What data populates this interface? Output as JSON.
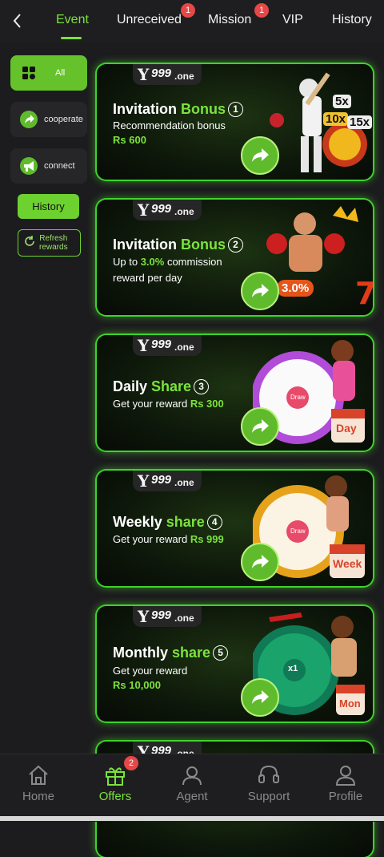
{
  "nav": {
    "back_icon": "chevron-left-icon",
    "tabs": [
      {
        "label": "Event",
        "active": true
      },
      {
        "label": "Unreceived",
        "badge": "1"
      },
      {
        "label": "Mission",
        "badge": "1"
      },
      {
        "label": "VIP"
      },
      {
        "label": "History"
      }
    ]
  },
  "sidebar": {
    "items": [
      {
        "label": "All",
        "icon": "grid-icon",
        "active": true
      },
      {
        "label": "cooperate",
        "icon": "share-arrow-icon"
      },
      {
        "label": "connect",
        "icon": "megaphone-icon"
      }
    ],
    "history_label": "History",
    "refresh_label_1": "Refresh",
    "refresh_label_2": "rewards"
  },
  "brand": {
    "y": "Y",
    "n": "999",
    "one": ".one"
  },
  "cards": [
    {
      "title_a": "Invitation ",
      "title_b": "Bonus",
      "num": "1",
      "line1": "Recommendation bonus",
      "line2_amount": "Rs 600"
    },
    {
      "title_a": "Invitation ",
      "title_b": "Bonus",
      "num": "2",
      "line1_pre": "Up to ",
      "line1_hi": "3.0%",
      "line1_post": " commission",
      "line2": "reward per day"
    },
    {
      "title_a": "Daily ",
      "title_b": "Share",
      "num": "3",
      "line1_pre": "Get your reward ",
      "line1_hi": "Rs 300"
    },
    {
      "title_a": "Weekly ",
      "title_b": "share",
      "num": "4",
      "line1_pre": "Get your reward ",
      "line1_hi": "Rs 999"
    },
    {
      "title_a": "Monthly ",
      "title_b": "share",
      "num": "5",
      "line1": "Get your reward",
      "line2_amount": "Rs 10,000"
    }
  ],
  "art_text": {
    "multipliers": [
      "5x",
      "10x",
      "15x"
    ],
    "percent": "3.0%",
    "day": "Day",
    "week": "Week",
    "mon": "Mon",
    "wheel_center": "Draw",
    "monthly_center": "x1"
  },
  "bottom_nav": [
    {
      "label": "Home",
      "icon": "home-icon"
    },
    {
      "label": "Offers",
      "icon": "gift-icon",
      "active": true,
      "badge": "2"
    },
    {
      "label": "Agent",
      "icon": "agent-icon"
    },
    {
      "label": "Support",
      "icon": "headset-icon"
    },
    {
      "label": "Profile",
      "icon": "profile-icon"
    }
  ],
  "colors": {
    "accent": "#7be23c",
    "card_glow": "#3bd42b",
    "badge": "#e64747"
  }
}
